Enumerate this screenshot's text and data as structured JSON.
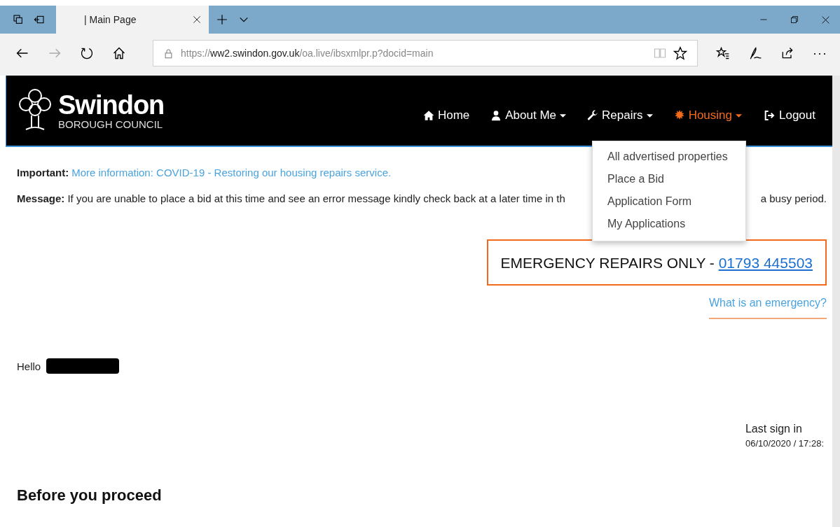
{
  "browser": {
    "tab_title": "| Main Page",
    "url_prefix": "https://",
    "url_host": "ww2.swindon.gov.uk",
    "url_path": "/oa.live/ibsxmlpr.p?docid=main",
    "more_label": "···"
  },
  "site": {
    "logo_name": "Swindon",
    "logo_sub": "BOROUGH COUNCIL"
  },
  "nav": [
    {
      "kind": "home",
      "label": "Home",
      "dropdown": false,
      "selected": false
    },
    {
      "kind": "user",
      "label": "About Me",
      "dropdown": true,
      "selected": false
    },
    {
      "kind": "wrench",
      "label": "Repairs",
      "dropdown": true,
      "selected": false
    },
    {
      "kind": "burst",
      "label": "Housing",
      "dropdown": true,
      "selected": true
    },
    {
      "kind": "logout",
      "label": "Logout",
      "dropdown": false,
      "selected": false
    }
  ],
  "dropdown_menu": [
    "All advertised properties",
    "Place a Bid",
    "Application Form",
    "My Applications"
  ],
  "important": {
    "label": "Important:",
    "link": "More information: COVID-19 - Restoring our housing repairs service."
  },
  "message": {
    "label": "Message:",
    "text_start": "If you are unable to place a bid at this time and see an error message kindly check back at a later time in th",
    "text_end": "a busy period."
  },
  "emergency": {
    "text": "EMERGENCY REPAIRS ONLY - ",
    "phone": "01793 445503",
    "link": "What is an emergency?"
  },
  "greeting": "Hello",
  "last_sign_in": {
    "label": "Last sign in",
    "value": "06/10/2020 / 17:28:"
  },
  "heading": "Before you proceed"
}
